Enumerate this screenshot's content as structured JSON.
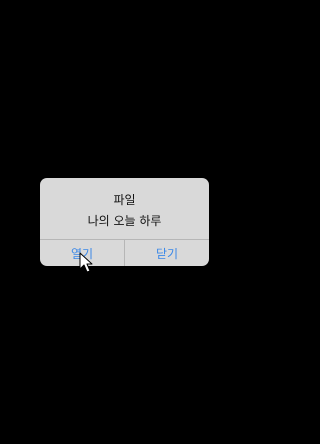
{
  "dialog": {
    "title": "파일",
    "message": "나의 오늘 하루",
    "open_label": "열기",
    "close_label": "닫기"
  },
  "colors": {
    "background": "#000000",
    "dialog_bg": "#d9d9d9",
    "button_text": "#3b88e8",
    "divider": "#b6b6b6"
  },
  "icons": {
    "cursor": "pointer-arrow-icon"
  }
}
